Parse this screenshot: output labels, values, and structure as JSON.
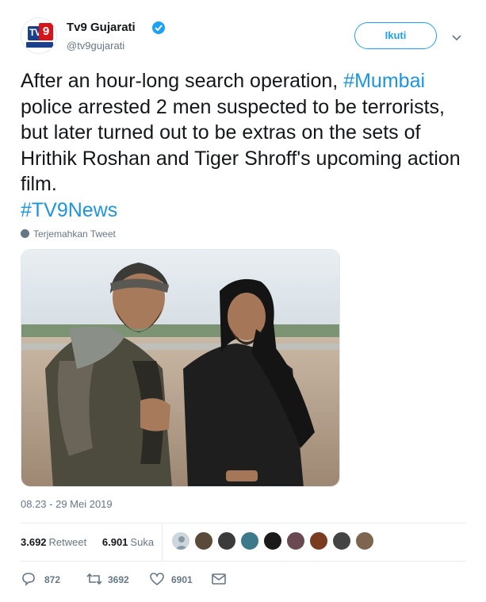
{
  "header": {
    "display_name": "Tv9 Gujarati",
    "handle": "@tv9gujarati",
    "follow_label": "Ikuti",
    "avatar_text": "TV",
    "avatar_digit": "9"
  },
  "tweet": {
    "text_parts": [
      {
        "text": "After an hour-long search operation, ",
        "hashtag": false
      },
      {
        "text": "#Mumbai",
        "hashtag": true
      },
      {
        "text": " police arrested 2 men suspected to be terrorists, but later turned out to be extras on the sets of Hrithik Roshan and Tiger Shroff's upcoming action film. ",
        "hashtag": false
      },
      {
        "text": "#TV9News",
        "hashtag": true
      }
    ],
    "translate_label": "Terjemahkan Tweet",
    "timestamp": "08.23 - 29 Mei 2019"
  },
  "stats": {
    "retweets": "3.692",
    "retweets_label": "Retweet",
    "likes": "6.901",
    "likes_label": "Suka"
  },
  "actions": {
    "reply_count": "872",
    "retweet_count": "3692",
    "like_count": "6901"
  },
  "colors": {
    "accent": "#1da1f2",
    "hashtag": "#1b95e0",
    "muted": "#657786"
  }
}
